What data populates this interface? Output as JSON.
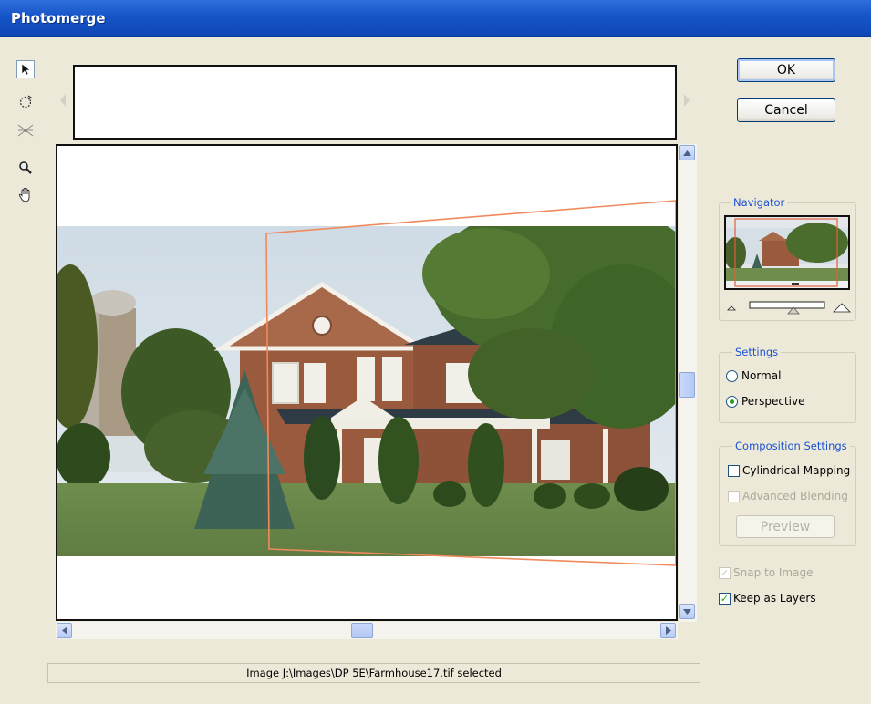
{
  "window": {
    "title": "Photomerge"
  },
  "tools": [
    {
      "name": "select-image-tool",
      "icon": "arrow-pointer-icon",
      "active": true
    },
    {
      "name": "rotate-image-tool",
      "icon": "rotate-icon",
      "active": false
    },
    {
      "name": "set-vanishing-point-tool",
      "icon": "vanishing-point-icon",
      "active": false
    },
    {
      "name": "zoom-tool",
      "icon": "magnifier-icon",
      "active": false
    },
    {
      "name": "hand-tool",
      "icon": "hand-icon",
      "active": false
    }
  ],
  "buttons": {
    "ok": "OK",
    "cancel": "Cancel",
    "preview": "Preview"
  },
  "navigator": {
    "label": "Navigator"
  },
  "settings": {
    "label": "Settings",
    "options": [
      {
        "label": "Normal",
        "selected": false
      },
      {
        "label": "Perspective",
        "selected": true
      }
    ]
  },
  "composition": {
    "label": "Composition Settings",
    "cylindrical": {
      "label": "Cylindrical Mapping",
      "checked": false,
      "enabled": true
    },
    "advanced": {
      "label": "Advanced Blending",
      "checked": false,
      "enabled": false
    }
  },
  "options": {
    "snap": {
      "label": "Snap to Image",
      "checked": true,
      "enabled": false
    },
    "layers": {
      "label": "Keep as Layers",
      "checked": true,
      "enabled": true
    }
  },
  "status": {
    "text": "Image J:\\Images\\DP 5E\\Farmhouse17.tif selected"
  },
  "colors": {
    "titlebar": "#1554c8",
    "group_label": "#1d52d6",
    "selection_outline": "#f08a5d",
    "check_mark": "#21a121"
  }
}
